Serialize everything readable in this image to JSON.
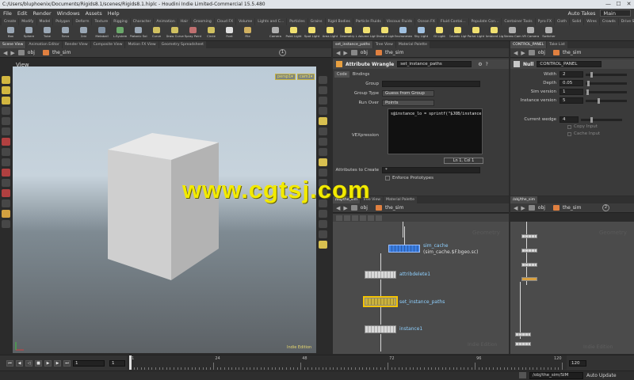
{
  "window": {
    "title": "C:/Users/bluphoenix/Documents/Rigids8.1/scenes/Rigids8.1.hiplc - Houdini Indie Limited-Commercial 15.5.480",
    "min": "—",
    "max": "☐",
    "close": "✕"
  },
  "menubar": {
    "items": [
      "File",
      "Edit",
      "Render",
      "Windows",
      "Assets",
      "Help"
    ],
    "auto_takes": "Auto Takes",
    "desktop": "Main"
  },
  "shelf_tabs": [
    "Create",
    "Modify",
    "Model",
    "Polygon",
    "Deform",
    "Texture",
    "Rigging",
    "Character",
    "Animation",
    "Hair",
    "Grooming",
    "Cloud FX",
    "Volume",
    "Lights and C...",
    "Particles",
    "Grains",
    "Rigid Bodies",
    "Particle Fluids",
    "Viscous Fluids",
    "Ocean FX",
    "Fluid Contai...",
    "Populate Con...",
    "Container Tools",
    "Pyro FX",
    "Cloth",
    "Solid",
    "Wires",
    "Crowds",
    "Drive Simula..."
  ],
  "tools_left": [
    {
      "label": "Box",
      "color": "#9aa7b5"
    },
    {
      "label": "Sphere",
      "color": "#9aa7b5"
    },
    {
      "label": "Tube",
      "color": "#9aa7b5"
    },
    {
      "label": "Torus",
      "color": "#9aa7b5"
    },
    {
      "label": "Grid",
      "color": "#9aa7b5"
    },
    {
      "label": "Metaball",
      "color": "#7f8fa0"
    },
    {
      "label": "L-System",
      "color": "#6aa86a"
    },
    {
      "label": "Platonic Sol...",
      "color": "#9aa7b5"
    },
    {
      "label": "Curve",
      "color": "#d0c060"
    },
    {
      "label": "Draw Curve",
      "color": "#d0c060"
    },
    {
      "label": "Spray Paint",
      "color": "#c07070"
    },
    {
      "label": "Circle",
      "color": "#d0c060"
    },
    {
      "label": "Font",
      "color": "#e0e0e0"
    },
    {
      "label": "File",
      "color": "#d0b060"
    }
  ],
  "tools_right": [
    {
      "label": "Camera",
      "color": "#b0b0b0"
    },
    {
      "label": "Point Light",
      "color": "#f0e070"
    },
    {
      "label": "Spot Light",
      "color": "#f0e070"
    },
    {
      "label": "Area Light",
      "color": "#f0e070"
    },
    {
      "label": "Geometry L...",
      "color": "#f0e070"
    },
    {
      "label": "Volume Light",
      "color": "#f0e070"
    },
    {
      "label": "Distant Light",
      "color": "#f0e070"
    },
    {
      "label": "Environmen...",
      "color": "#a0c0e0"
    },
    {
      "label": "Sky Light",
      "color": "#a0c0e0"
    },
    {
      "label": "GI Light",
      "color": "#f0e070"
    },
    {
      "label": "Caustic Light",
      "color": "#f0e070"
    },
    {
      "label": "Portal Light",
      "color": "#f0e070"
    },
    {
      "label": "Ambient Lig...",
      "color": "#f0e070"
    },
    {
      "label": "Stereo Cam",
      "color": "#b0b0b0"
    },
    {
      "label": "VR Camera",
      "color": "#b0b0b0"
    },
    {
      "label": "Switcher",
      "color": "#b0b0b0"
    }
  ],
  "left_pane": {
    "tabs": [
      "Scene View",
      "Animation Editor",
      "Render View",
      "Composite View",
      "Motion FX View",
      "Geometry Spreadsheet"
    ],
    "path_obj": "obj",
    "path_node": "the_sim",
    "view_label": "View",
    "persp": "persp1▾",
    "cam": "cam1▾",
    "indie": "Indie Edition",
    "badge": "1"
  },
  "param_pane": {
    "tabs": [
      "set_instance_paths",
      "Tree View",
      "Material Palette"
    ],
    "node_type": "Attribute Wrangle",
    "node_name": "set_instance_paths",
    "subtabs": [
      "Code",
      "Bindings"
    ],
    "group_label": "Group",
    "group_value": "",
    "group_type_label": "Group Type",
    "group_type_value": "Guess from Group",
    "run_over_label": "Run Over",
    "run_over_value": "Points",
    "vex_label": "VEXpression",
    "vex_code": "s@instance_lo = sprintf(\"$JOB/instance",
    "cursor_pos": "Ln 1, Col 1",
    "attrs_create_label": "Attributes to Create",
    "attrs_create_value": "*",
    "enforce_label": "Enforce Prototypes"
  },
  "control_pane": {
    "tabs": [
      "CONTROL_PANEL",
      "Take List"
    ],
    "node_type": "Null",
    "node_name": "CONTROL_PANEL",
    "params": [
      {
        "label": "Width",
        "value": "2",
        "slider": 0.12
      },
      {
        "label": "Depth",
        "value": "0.05",
        "slider": 0.04
      },
      {
        "label": "Sim version",
        "value": "1",
        "slider": 0.02
      },
      {
        "label": "Instance version",
        "value": "5",
        "slider": 0.3
      }
    ],
    "current_wedge_label": "Current wedge",
    "current_wedge_value": "4",
    "current_wedge_slider": 0.25,
    "copy_input": "Copy Input",
    "cache_input": "Cache Input"
  },
  "network_pane": {
    "tabs": [
      "/obj/the_sim",
      "Tree View",
      "Material Palette"
    ],
    "path_obj": "obj",
    "path_node": "the_sim",
    "nodes": [
      {
        "label": "sim_cache",
        "sub": "(sim_cache.$F.bgeo.sc)"
      },
      {
        "label": "attribdelete1",
        "sub": ""
      },
      {
        "label": "set_instance_paths",
        "sub": ""
      },
      {
        "label": "instance1",
        "sub": ""
      }
    ],
    "geometry_watermark": "Geometry",
    "indie_watermark": "Indie Edition"
  },
  "small_net_pane": {
    "tabs": [
      "/obj/the_sim"
    ],
    "path_obj": "obj",
    "path_node": "the_sim",
    "badge": "2",
    "watermark": "Geometry",
    "indie_watermark": "Indie Edition"
  },
  "timeline": {
    "frame": "1",
    "start": "1",
    "end": "120",
    "ticks": [
      "1",
      "24",
      "48",
      "72",
      "96"
    ],
    "end_label": "120",
    "range_end": "120"
  },
  "status": {
    "path": "/obj/the_sim/SIM",
    "auto_update": "Auto Update"
  },
  "watermark": "www.cgtsj.com"
}
